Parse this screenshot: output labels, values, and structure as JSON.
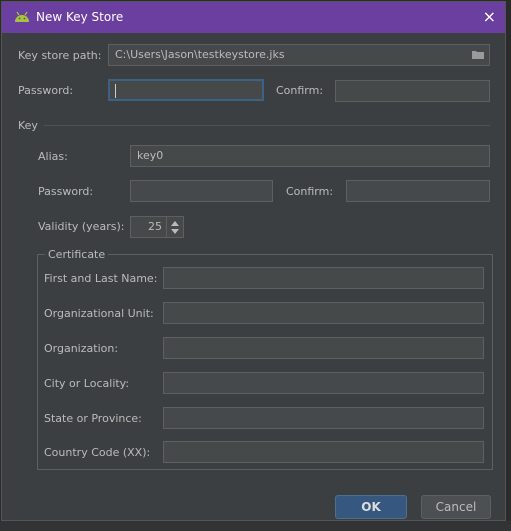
{
  "window": {
    "title": "New Key Store",
    "close_glyph": "×",
    "icon": "android-icon"
  },
  "keystore": {
    "path_label": "Key store path:",
    "path_value": "C:\\Users\\Jason\\testkeystore.jks",
    "browse_icon": "folder-icon",
    "password_label": "Password:",
    "password_value": "",
    "confirm_label": "Confirm:",
    "confirm_value": ""
  },
  "key": {
    "section_label": "Key",
    "alias_label": "Alias:",
    "alias_value": "key0",
    "password_label": "Password:",
    "password_value": "",
    "confirm_label": "Confirm:",
    "confirm_value": "",
    "validity_label": "Validity (years):",
    "validity_value": "25"
  },
  "certificate": {
    "group_label": "Certificate",
    "fields": [
      {
        "label": "First and Last Name:",
        "value": ""
      },
      {
        "label": "Organizational Unit:",
        "value": ""
      },
      {
        "label": "Organization:",
        "value": ""
      },
      {
        "label": "City or Locality:",
        "value": ""
      },
      {
        "label": "State or Province:",
        "value": ""
      },
      {
        "label": "Country Code (XX):",
        "value": ""
      }
    ]
  },
  "buttons": {
    "ok": "OK",
    "cancel": "Cancel"
  },
  "colors": {
    "titlebar": "#6b3fa0",
    "dialog_bg": "#3c3f41",
    "field_bg": "#45494a",
    "ok_button": "#365880",
    "focus_border": "#3d6185"
  }
}
